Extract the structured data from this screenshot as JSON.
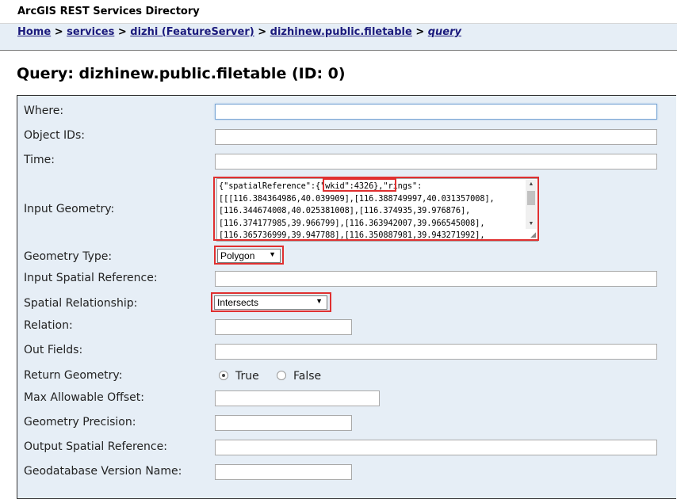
{
  "app": {
    "title": "ArcGIS REST Services Directory"
  },
  "breadcrumb": {
    "items": [
      "Home",
      "services",
      "dizhi (FeatureServer)",
      "dizhinew.public.filetable",
      "query"
    ],
    "separator": ">"
  },
  "page": {
    "title": "Query: dizhinew.public.filetable (ID: 0)"
  },
  "form": {
    "where": {
      "label": "Where:",
      "value": ""
    },
    "object_ids": {
      "label": "Object IDs:",
      "value": ""
    },
    "time": {
      "label": "Time:",
      "value": ""
    },
    "input_geometry": {
      "label": "Input Geometry:",
      "lines": [
        "{\"spatialReference\":{\"wkid\":4326},\"rings\":",
        "[[[116.384364986,40.039909],[116.388749997,40.031357008],",
        "[116.344674008,40.025381008],[116.374935,39.976876],",
        "[116.374177985,39.966799],[116.363942007,39.966545008],",
        "[116.365736999,39.947788],[116.350887981,39.943271992],"
      ]
    },
    "geometry_type": {
      "label": "Geometry Type:",
      "value": "Polygon"
    },
    "input_sr": {
      "label": "Input Spatial Reference:",
      "value": ""
    },
    "spatial_rel": {
      "label": "Spatial Relationship:",
      "value": "Intersects"
    },
    "relation": {
      "label": "Relation:",
      "value": ""
    },
    "out_fields": {
      "label": "Out Fields:",
      "value": ""
    },
    "return_geometry": {
      "label": "Return Geometry:",
      "options": [
        "True",
        "False"
      ],
      "selected": "True"
    },
    "max_offset": {
      "label": "Max Allowable Offset:",
      "value": ""
    },
    "geom_precision": {
      "label": "Geometry Precision:",
      "value": ""
    },
    "out_sr": {
      "label": "Output Spatial Reference:",
      "value": ""
    },
    "gdb_version": {
      "label": "Geodatabase Version Name:",
      "value": ""
    }
  },
  "colors": {
    "nav_bg": "#e6eef6",
    "link": "#1b1a7c",
    "highlight": "#e03030"
  },
  "icons": {
    "dropdown": "triangle-down-icon",
    "scroll_up": "triangle-up-icon",
    "resize": "resize-grip-icon"
  }
}
